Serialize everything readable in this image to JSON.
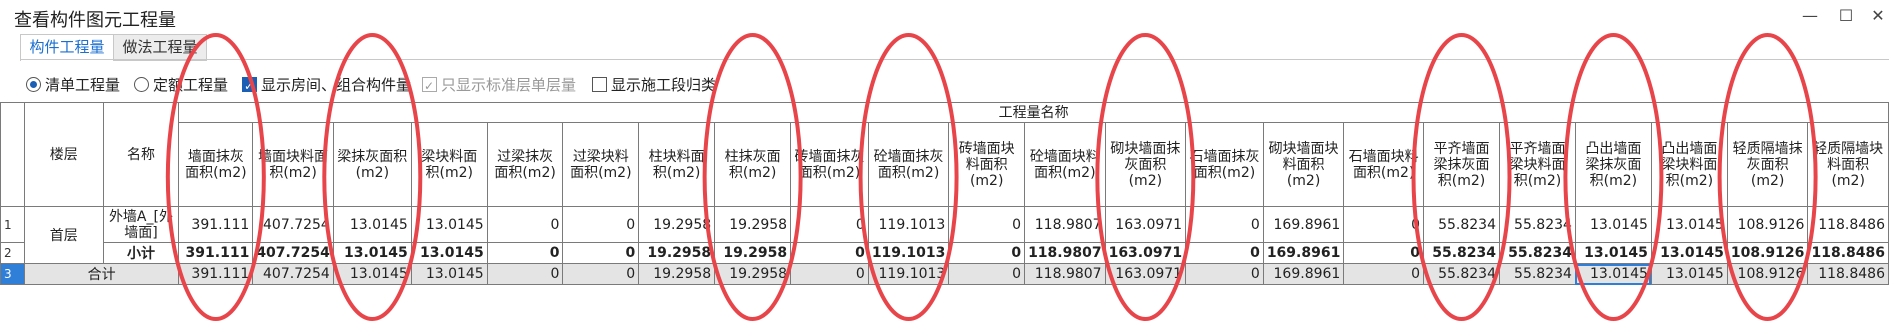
{
  "window": {
    "title": "查看构件图元工程量",
    "minimize_icon": "—",
    "maximize_icon": "☐",
    "close_icon": "✕"
  },
  "tabs": [
    {
      "label": "构件工程量",
      "active": true
    },
    {
      "label": "做法工程量",
      "active": false
    }
  ],
  "options": {
    "radio_bill": "清单工程量",
    "radio_quota": "定额工程量",
    "check_show_room": "显示房间、组合构件量",
    "check_standard_floor": "只显示标准层单层量",
    "check_construction": "显示施工段归类"
  },
  "table": {
    "group_header": "工程量名称",
    "col_floor": "楼层",
    "col_name": "名称",
    "columns": [
      "墙面抹灰面积(m2)",
      "墙面块料面积(m2)",
      "梁抹灰面积(m2)",
      "梁块料面积(m2)",
      "过梁抹灰面积(m2)",
      "过梁块料面积(m2)",
      "柱块料面积(m2)",
      "柱抹灰面积(m2)",
      "砖墙面抹灰面积(m2)",
      "砼墙面抹灰面积(m2)",
      "砖墙面块料面积(m2)",
      "砼墙面块料面积(m2)",
      "砌块墙面抹灰面积(m2)",
      "石墙面抹灰面积(m2)",
      "砌块墙面块料面积(m2)",
      "石墙面块料面积(m2)",
      "平齐墙面梁抹灰面积(m2)",
      "平齐墙面梁块料面积(m2)",
      "凸出墙面梁抹灰面积(m2)",
      "凸出墙面梁块料面积(m2)",
      "轻质隔墙抹灰面积(m2)",
      "轻质隔墙块料面积(m2)"
    ],
    "row_numbers": [
      "1",
      "2",
      "3"
    ],
    "floor": "首层",
    "row1_name": "外墙A_[外墙面]",
    "row1": [
      "391.111",
      "407.7254",
      "13.0145",
      "13.0145",
      "0",
      "0",
      "19.2958",
      "19.2958",
      "0",
      "119.1013",
      "0",
      "118.9807",
      "163.0971",
      "0",
      "169.8961",
      "0",
      "55.8234",
      "55.8234",
      "13.0145",
      "13.0145",
      "108.9126",
      "118.8486"
    ],
    "subtotal_label": "小计",
    "row2": [
      "391.111",
      "407.7254",
      "13.0145",
      "13.0145",
      "0",
      "0",
      "19.2958",
      "19.2958",
      "0",
      "119.1013",
      "0",
      "118.9807",
      "163.0971",
      "0",
      "169.8961",
      "0",
      "55.8234",
      "55.8234",
      "13.0145",
      "13.0145",
      "108.9126",
      "118.8486"
    ],
    "total_label": "合计",
    "row3": [
      "391.111",
      "407.7254",
      "13.0145",
      "13.0145",
      "0",
      "0",
      "19.2958",
      "19.2958",
      "0",
      "119.1013",
      "0",
      "118.9807",
      "163.0971",
      "0",
      "169.8961",
      "0",
      "55.8234",
      "55.8234",
      "13.0145",
      "13.0145",
      "108.9126",
      "118.8486"
    ]
  },
  "annotation": {
    "oval_color": "#e8454a",
    "circled_columns": [
      "墙面抹灰面积(m2)",
      "梁抹灰面积(m2)",
      "柱抹灰面积(m2)",
      "砼墙面抹灰面积(m2)",
      "砌块墙面抹灰面积(m2)",
      "平齐墙面梁抹灰面积(m2)",
      "凸出墙面梁抹灰面积(m2)",
      "轻质隔墙抹灰面积(m2)"
    ]
  },
  "accent_color": "#1a6fd1"
}
